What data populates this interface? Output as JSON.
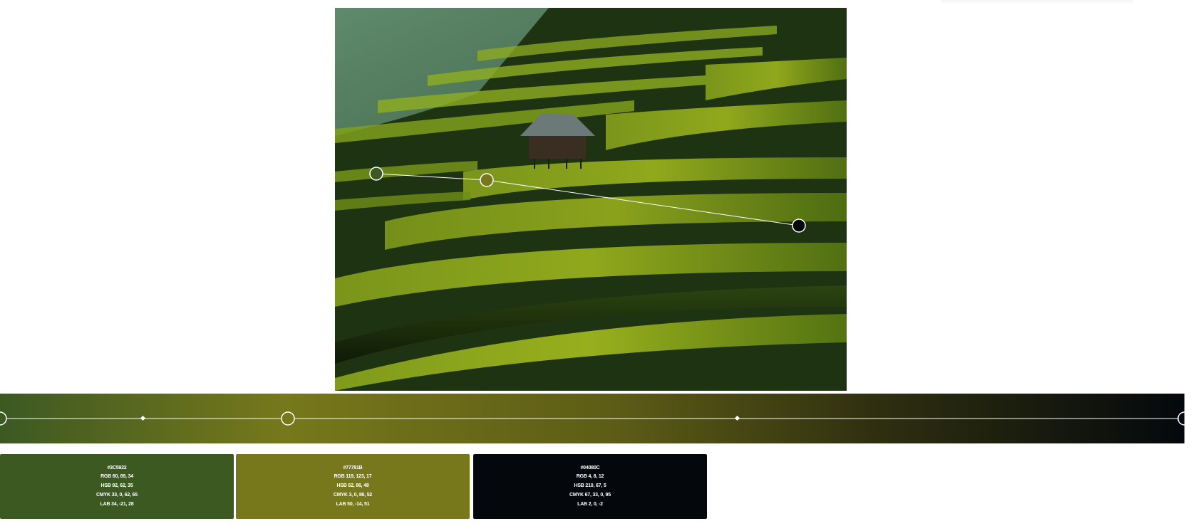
{
  "palette": {
    "photo_description_icon": "terraced-rice-field-photo",
    "gradient_stops": [
      "#3C5922",
      "#77781B",
      "#04080C"
    ],
    "swatches": [
      {
        "hex": "#3C5922",
        "color": "#3C5922",
        "rgb": "RGB 60, 89, 34",
        "hsb": "HSB 92, 62, 35",
        "cmyk": "CMYK 33, 0, 62, 65",
        "lab": "LAB 34, -21, 28"
      },
      {
        "hex": "#77781B",
        "color": "#77781B",
        "rgb": "RGB 119, 123, 17",
        "hsb": "HSB 62, 86, 48",
        "cmyk": "CMYK 3, 0, 86, 52",
        "lab": "LAB 50, -14, 51"
      },
      {
        "hex": "#04080C",
        "color": "#04080C",
        "rgb": "RGB 4, 8, 12",
        "hsb": "HSB 210, 67, 5",
        "cmyk": "CMYK 67, 33, 0, 95",
        "lab": "LAB 2, 0, -2"
      }
    ]
  }
}
